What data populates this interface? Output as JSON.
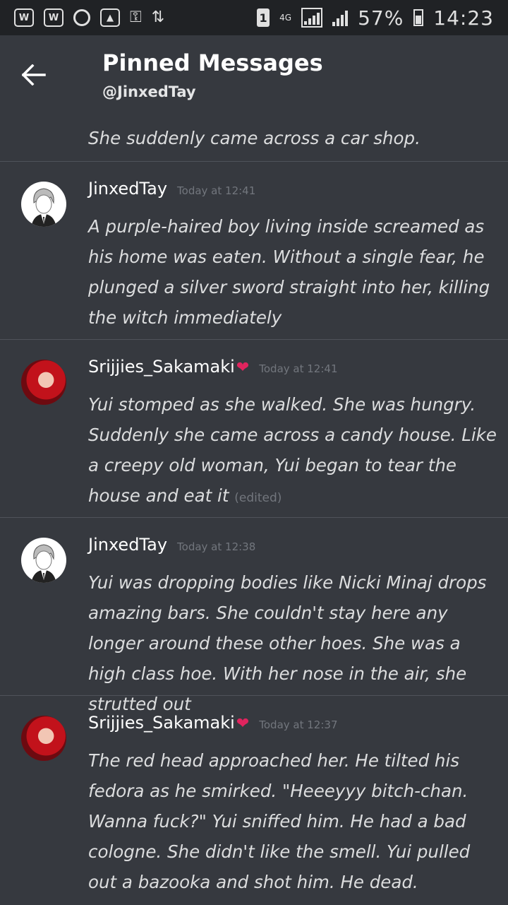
{
  "status_bar": {
    "sim": "1",
    "network": "4G",
    "battery": "57%",
    "time": "14:23"
  },
  "header": {
    "title": "Pinned Messages",
    "subtitle": "@JinxedTay"
  },
  "partial_message": {
    "text": "She suddenly came across a car shop."
  },
  "messages": [
    {
      "author": "JinxedTay",
      "timestamp": "Today at 12:41",
      "text": "A purple-haired boy living inside screamed as his home was eaten. Without a single fear, he plunged a silver sword straight into her, killing the witch immediately",
      "edited": ""
    },
    {
      "author": "Srijjies_Sakamaki",
      "timestamp": "Today at 12:41",
      "text": "Yui stomped as she walked. She was hungry. Suddenly she came across a candy house. Like a creepy old woman, Yui began to tear the house and eat it",
      "edited": "(edited)"
    },
    {
      "author": "JinxedTay",
      "timestamp": "Today at 12:38",
      "text": "Yui was dropping bodies like Nicki Minaj drops amazing bars. She couldn't stay here any longer around these other hoes. She was a high class hoe. With her nose in the air, she strutted out",
      "edited": ""
    },
    {
      "author": "Srijjies_Sakamaki",
      "timestamp": "Today at 12:37",
      "text": "The red head approached her. He tilted his fedora as he smirked. \"Heeeyyy bitch-chan. Wanna fuck?\" Yui sniffed him. He had a bad cologne. She didn't like the smell. Yui pulled out a bazooka and shot him. He dead.",
      "edited": ""
    }
  ],
  "colors": {
    "background": "#36393f",
    "status_bar": "#202225",
    "divider": "#4f535a",
    "timestamp": "#72767d",
    "heart": "#e0245e"
  }
}
